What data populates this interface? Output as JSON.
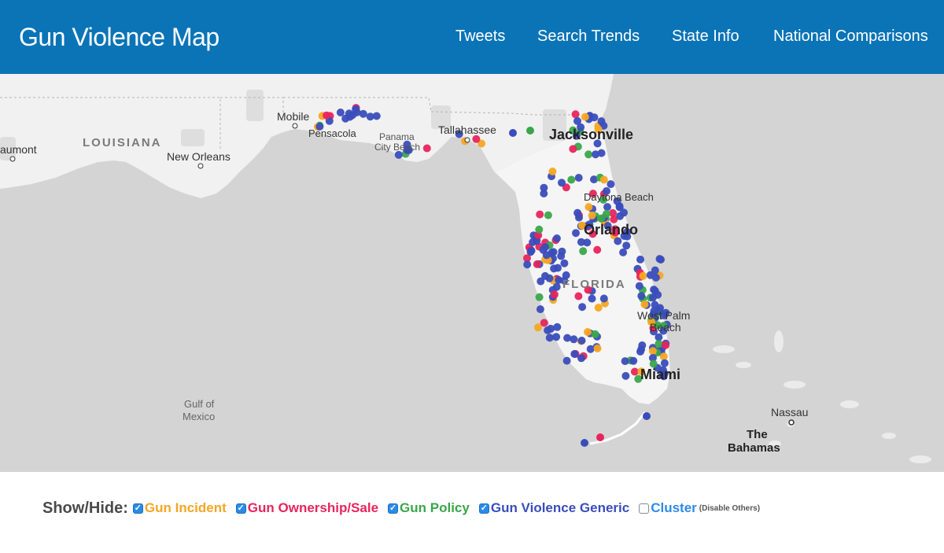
{
  "header": {
    "title": "Gun Violence Map",
    "nav": [
      "Tweets",
      "Search Trends",
      "State Info",
      "National Comparisons"
    ]
  },
  "map": {
    "places": {
      "louisiana": "LOUISIANA",
      "beaumont": "aumont",
      "new_orleans": "New Orleans",
      "mobile": "Mobile",
      "pensacola": "Pensacola",
      "panama": "Panama",
      "panama_city_beach": "City Beach",
      "tallahassee": "Tallahassee",
      "jacksonville": "Jacksonville",
      "daytona": "Daytona Beach",
      "orlando": "Orlando",
      "florida": "FLORIDA",
      "west_palm": "West Palm",
      "west_palm_beach": "Beach",
      "miami": "Miami",
      "gulf_1": "Gulf of",
      "gulf_2": "Mexico",
      "nassau": "Nassau",
      "bahamas_1": "The",
      "bahamas_2": "Bahamas"
    },
    "colors": {
      "incident": "#f5a623",
      "ownership": "#e8245c",
      "policy": "#3aa64a",
      "generic": "#3a4dbb"
    }
  },
  "legend": {
    "label": "Show/Hide:",
    "items": [
      {
        "label": "Gun Incident",
        "color": "#f5a623",
        "checked": true
      },
      {
        "label": "Gun Ownership/Sale",
        "color": "#e8245c",
        "checked": true
      },
      {
        "label": "Gun Policy",
        "color": "#3aa64a",
        "checked": true
      },
      {
        "label": "Gun Violence Generic",
        "color": "#3a4dbb",
        "checked": true
      },
      {
        "label": "Cluster",
        "color": "#2a8be8",
        "checked": false
      }
    ],
    "note": "(Disable Others)"
  }
}
